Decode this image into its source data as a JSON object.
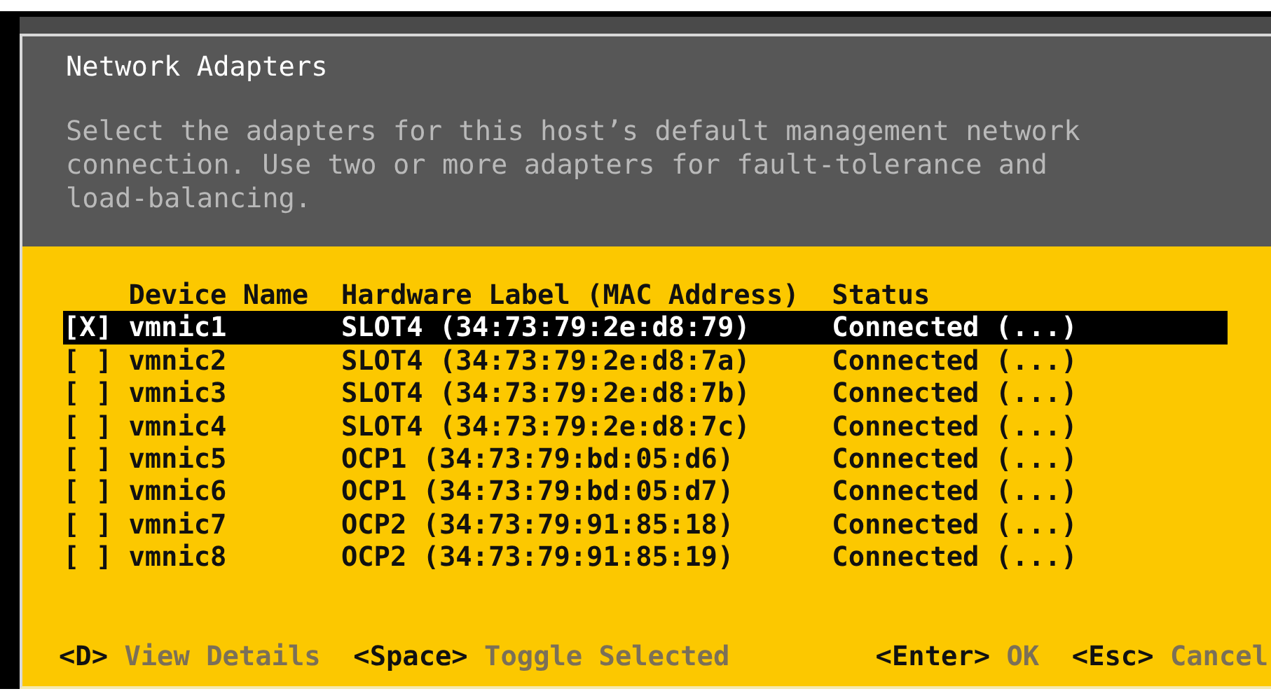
{
  "dialog": {
    "title": "Network Adapters",
    "description": "Select the adapters for this host’s default management network connection. Use two or more adapters for fault-tolerance and load-balancing."
  },
  "table": {
    "columns": [
      "Device Name",
      "Hardware Label (MAC Address)",
      "Status"
    ],
    "rows": [
      {
        "checkbox": "[X]",
        "device": "vmnic1",
        "hardware": "SLOT4 (34:73:79:2e:d8:79)",
        "status": "Connected (...)",
        "selected": true
      },
      {
        "checkbox": "[ ]",
        "device": "vmnic2",
        "hardware": "SLOT4 (34:73:79:2e:d8:7a)",
        "status": "Connected (...)",
        "selected": false
      },
      {
        "checkbox": "[ ]",
        "device": "vmnic3",
        "hardware": "SLOT4 (34:73:79:2e:d8:7b)",
        "status": "Connected (...)",
        "selected": false
      },
      {
        "checkbox": "[ ]",
        "device": "vmnic4",
        "hardware": "SLOT4 (34:73:79:2e:d8:7c)",
        "status": "Connected (...)",
        "selected": false
      },
      {
        "checkbox": "[ ]",
        "device": "vmnic5",
        "hardware": "OCP1 (34:73:79:bd:05:d6)",
        "status": "Connected (...)",
        "selected": false
      },
      {
        "checkbox": "[ ]",
        "device": "vmnic6",
        "hardware": "OCP1 (34:73:79:bd:05:d7)",
        "status": "Connected (...)",
        "selected": false
      },
      {
        "checkbox": "[ ]",
        "device": "vmnic7",
        "hardware": "OCP2 (34:73:79:91:85:18)",
        "status": "Connected (...)",
        "selected": false
      },
      {
        "checkbox": "[ ]",
        "device": "vmnic8",
        "hardware": "OCP2 (34:73:79:91:85:19)",
        "status": "Connected (...)",
        "selected": false
      }
    ]
  },
  "footer": {
    "left": [
      {
        "key": "<D>",
        "label": "View Details"
      },
      {
        "key": "<Space>",
        "label": "Toggle Selected"
      }
    ],
    "right": [
      {
        "key": "<Enter>",
        "label": "OK"
      },
      {
        "key": "<Esc>",
        "label": "Cancel"
      }
    ]
  }
}
